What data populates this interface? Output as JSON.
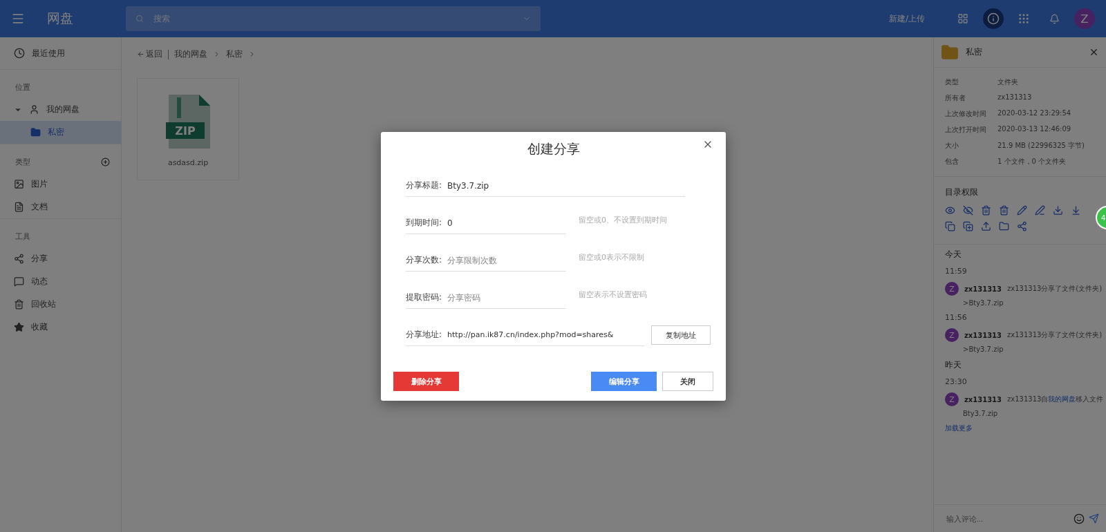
{
  "topbar": {
    "title": "网盘",
    "search": {
      "placeholder": "搜索"
    },
    "new_button": "新建/上传",
    "info_active": true,
    "avatar": "Z"
  },
  "sidebar": {
    "recent": "最近使用",
    "sections": [
      {
        "title": "位置",
        "kind": "tree",
        "items": [
          {
            "label": "我的网盘",
            "expanded": true,
            "selected": false,
            "children": [
              {
                "label": "私密",
                "selected": true
              }
            ]
          }
        ]
      },
      {
        "title": "类型",
        "kind": "list",
        "addable": true,
        "items": [
          {
            "label": "图片"
          },
          {
            "label": "文档"
          }
        ]
      },
      {
        "title": "工具",
        "kind": "list",
        "items": [
          {
            "label": "分享"
          },
          {
            "label": "动态"
          },
          {
            "label": "回收站"
          },
          {
            "label": "收藏"
          }
        ]
      }
    ]
  },
  "breadcrumb": {
    "back": "返回",
    "path": [
      "我的网盘",
      "私密"
    ]
  },
  "files": [
    {
      "name": "asdasd.zip",
      "badge": "ZIP"
    }
  ],
  "details": {
    "title": "私密",
    "properties": [
      {
        "label": "类型",
        "value": "文件夹"
      },
      {
        "label": "所有者",
        "value": "zx131313"
      },
      {
        "label": "上次修改时间",
        "value": "2020-03-12 23:29:54"
      },
      {
        "label": "上次打开时间",
        "value": "2020-03-13 12:46:09"
      },
      {
        "label": "大小",
        "value": "21.9 MB (22996325 字节)"
      },
      {
        "label": "包含",
        "value": "1 个文件，0 个文件夹"
      }
    ],
    "permissions_title": "目录权限",
    "activity": [
      {
        "day": "今天",
        "entries": [
          {
            "time": "11:59",
            "avatar": "Z",
            "user": "zx131313",
            "message": "zx131313分享了文件(文件夹)",
            "detail": ">Bty3.7.zip"
          },
          {
            "time": "11:56",
            "avatar": "Z",
            "user": "zx131313",
            "message": "zx131313分享了文件(文件夹)",
            "detail": ">Bty3.7.zip"
          }
        ]
      },
      {
        "day": "昨天",
        "entries": [
          {
            "time": "23:30",
            "avatar": "Z",
            "user": "zx131313",
            "message": "zx131313自",
            "link": "我的网盘",
            "message_end": "移入文件",
            "detail": "Bty3.7.zip"
          }
        ]
      }
    ],
    "load_more": "加载更多",
    "comment": {
      "placeholder": "输入评论..."
    }
  },
  "floating_badge": "4",
  "dialog": {
    "title": "创建分享",
    "fields": [
      {
        "label": "分享标题:",
        "value": "Bty3.7.zip",
        "kind": "wide"
      },
      {
        "label": "到期时间:",
        "value": "0",
        "hint": "留空或0、不设置到期时间",
        "kind": "hint"
      },
      {
        "label": "分享次数:",
        "placeholder": "分享限制次数",
        "hint": "留空或0表示不限制",
        "kind": "hint"
      },
      {
        "label": "提取密码:",
        "placeholder": "分享密码",
        "hint": "留空表示不设置密码",
        "kind": "hint"
      },
      {
        "label": "分享地址:",
        "value": "http://pan.ik87.cn/index.php?mod=shares&",
        "button": "复制地址",
        "kind": "copy"
      }
    ],
    "buttons": [
      {
        "label": "删除分享",
        "kind": "danger"
      },
      {
        "label": "编辑分享",
        "kind": "primary"
      },
      {
        "label": "关闭",
        "kind": "default"
      }
    ]
  }
}
